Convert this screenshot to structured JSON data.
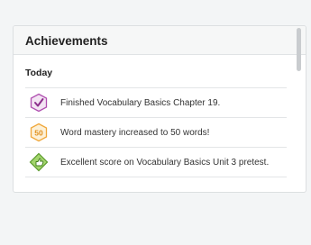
{
  "panel": {
    "title": "Achievements",
    "section_title": "Today",
    "items": [
      {
        "icon": "checkmark-badge-icon",
        "color": "#b04fb0",
        "badge_text": "",
        "text": "Finished Vocabulary Basics Chapter 19."
      },
      {
        "icon": "hexagon-50-badge-icon",
        "color": "#f0a73a",
        "badge_text": "50",
        "text": "Word mastery increased to 50 words!"
      },
      {
        "icon": "thumbs-up-diamond-icon",
        "color": "#6cb53a",
        "badge_text": "",
        "text": "Excellent score on Vocabulary Basics Unit 3 pretest."
      }
    ]
  }
}
